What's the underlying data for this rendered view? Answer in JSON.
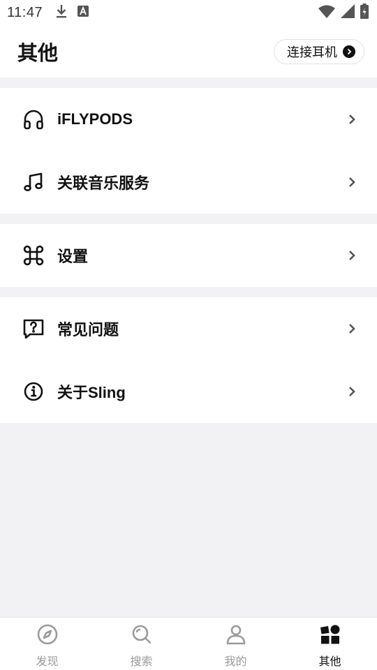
{
  "status_bar": {
    "time": "11:47",
    "icons": [
      "download-icon",
      "a-notification-icon",
      "wifi-icon",
      "cell-signal-icon",
      "battery-icon"
    ]
  },
  "header": {
    "title": "其他",
    "connect_label": "连接耳机"
  },
  "groups": [
    {
      "items": [
        {
          "icon": "headphones-icon",
          "label": "iFLYPODS"
        },
        {
          "icon": "music-note-icon",
          "label": "关联音乐服务"
        }
      ]
    },
    {
      "items": [
        {
          "icon": "command-icon",
          "label": "设置"
        }
      ]
    },
    {
      "items": [
        {
          "icon": "question-icon",
          "label": "常见问题"
        },
        {
          "icon": "info-icon",
          "label": "关于Sling"
        }
      ]
    }
  ],
  "tabs": [
    {
      "icon": "compass-icon",
      "label": "发现",
      "active": false
    },
    {
      "icon": "search-icon",
      "label": "搜索",
      "active": false
    },
    {
      "icon": "person-icon",
      "label": "我的",
      "active": false
    },
    {
      "icon": "shapes-icon",
      "label": "其他",
      "active": true
    }
  ],
  "colors": {
    "active": "#111111",
    "inactive": "#9a9a9a",
    "background": "#f2f2f4"
  }
}
